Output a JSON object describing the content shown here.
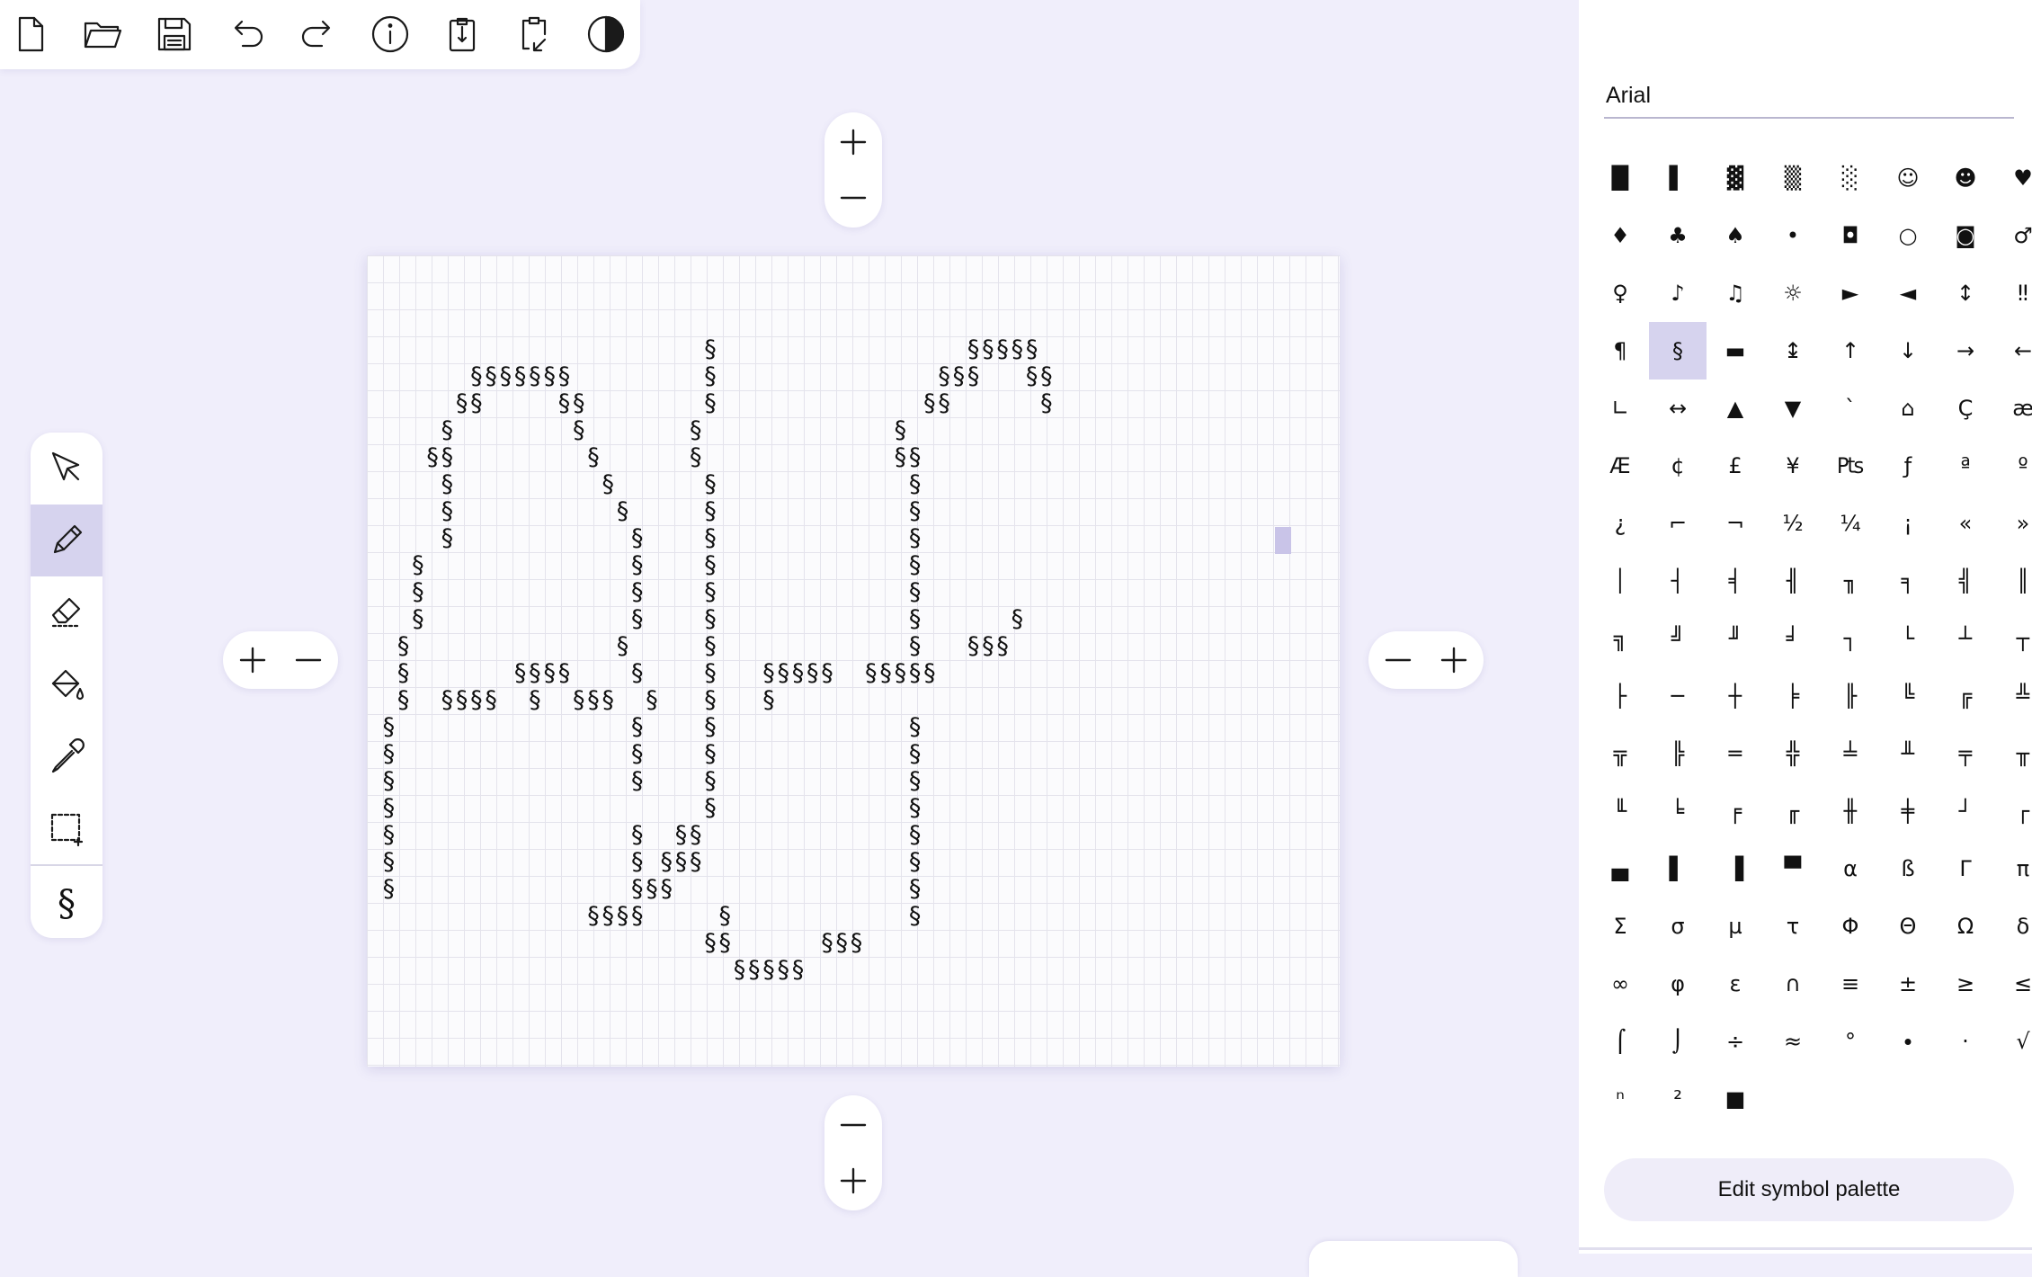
{
  "toolbar": {
    "buttons": [
      {
        "name": "new-file-icon"
      },
      {
        "name": "open-folder-icon"
      },
      {
        "name": "save-icon"
      },
      {
        "name": "undo-icon"
      },
      {
        "name": "redo-icon"
      },
      {
        "name": "info-icon"
      },
      {
        "name": "copy-clipboard-icon"
      },
      {
        "name": "paste-clipboard-icon"
      },
      {
        "name": "contrast-icon"
      }
    ]
  },
  "canvas": {
    "art_lines": [
      "",
      "",
      "",
      "                       §                 §§§§§",
      "       §§§§§§§         §               §§§   §§",
      "      §§     §§        §              §§      §",
      "     §        §       §             §",
      "    §§         §      §             §§",
      "     §          §      §             §",
      "     §           §     §             §",
      "     §            §    §             §",
      "   §              §    §             §",
      "   §              §    §             §",
      "   §              §    §             §      §",
      "  §              §     §             §   §§§",
      "  §       §§§§    §    §   §§§§§  §§§§§",
      "  §  §§§§  §  §§§  §   §   §",
      " §                §    §             §",
      " §                §    §             §",
      " §                §    §             §",
      " §                     §             §",
      " §                §  §§              §",
      " §                § §§§              §",
      " §                §§§                §",
      "               §§§§     §            §",
      "                       §§      §§§",
      "                         §§§§§"
    ],
    "cursor_label": ""
  },
  "zoom_controls": {
    "top": [
      "plus-icon",
      "minus-icon"
    ],
    "bottom": [
      "minus-icon",
      "plus-icon"
    ],
    "left": [
      "plus-icon",
      "minus-icon"
    ],
    "right": [
      "minus-icon",
      "plus-icon"
    ]
  },
  "tools": {
    "items": [
      {
        "name": "select-tool",
        "icon": "arrow-pointer-icon",
        "active": false
      },
      {
        "name": "pencil-tool",
        "icon": "pencil-icon",
        "active": true
      },
      {
        "name": "eraser-tool",
        "icon": "eraser-icon",
        "active": false
      },
      {
        "name": "fill-tool",
        "icon": "paint-bucket-icon",
        "active": false
      },
      {
        "name": "eyedropper-tool",
        "icon": "eyedropper-icon",
        "active": false
      },
      {
        "name": "marquee-tool",
        "icon": "selection-rectangle-icon",
        "active": false
      }
    ],
    "current_symbol": "§"
  },
  "symbol_panel": {
    "font": "Arial",
    "symbols": [
      "█",
      "▌",
      "▓",
      "▒",
      "░",
      "☺",
      "☻",
      "♥",
      "♦",
      "♣",
      "♠",
      "•",
      "◘",
      "○",
      "◙",
      "♂",
      "♀",
      "♪",
      "♫",
      "☼",
      "►",
      "◄",
      "↕",
      "‼",
      "¶",
      "§",
      "▬",
      "↨",
      "↑",
      "↓",
      "→",
      "←",
      "∟",
      "↔",
      "▲",
      "▼",
      "`",
      "⌂",
      "Ç",
      "æ",
      "Æ",
      "¢",
      "£",
      "¥",
      "₧",
      "ƒ",
      "ª",
      "º",
      "¿",
      "⌐",
      "¬",
      "½",
      "¼",
      "¡",
      "«",
      "»",
      "│",
      "┤",
      "╡",
      "╢",
      "╖",
      "╕",
      "╣",
      "║",
      "╗",
      "╝",
      "╜",
      "╛",
      "┐",
      "└",
      "┴",
      "┬",
      "├",
      "─",
      "┼",
      "╞",
      "╟",
      "╚",
      "╔",
      "╩",
      "╦",
      "╠",
      "═",
      "╬",
      "╧",
      "╨",
      "╤",
      "╥",
      "╙",
      "╘",
      "╒",
      "╓",
      "╫",
      "╪",
      "┘",
      "┌",
      "▄",
      "▌",
      "▐",
      "▀",
      "α",
      "ß",
      "Γ",
      "π",
      "Σ",
      "σ",
      "µ",
      "τ",
      "Φ",
      "Θ",
      "Ω",
      "δ",
      "∞",
      "φ",
      "ε",
      "∩",
      "≡",
      "±",
      "≥",
      "≤",
      "⌠",
      "⌡",
      "÷",
      "≈",
      "°",
      "∙",
      "·",
      "√",
      "ⁿ",
      "²",
      "■"
    ],
    "selected_symbol": "§",
    "edit_button_label": "Edit symbol palette"
  }
}
